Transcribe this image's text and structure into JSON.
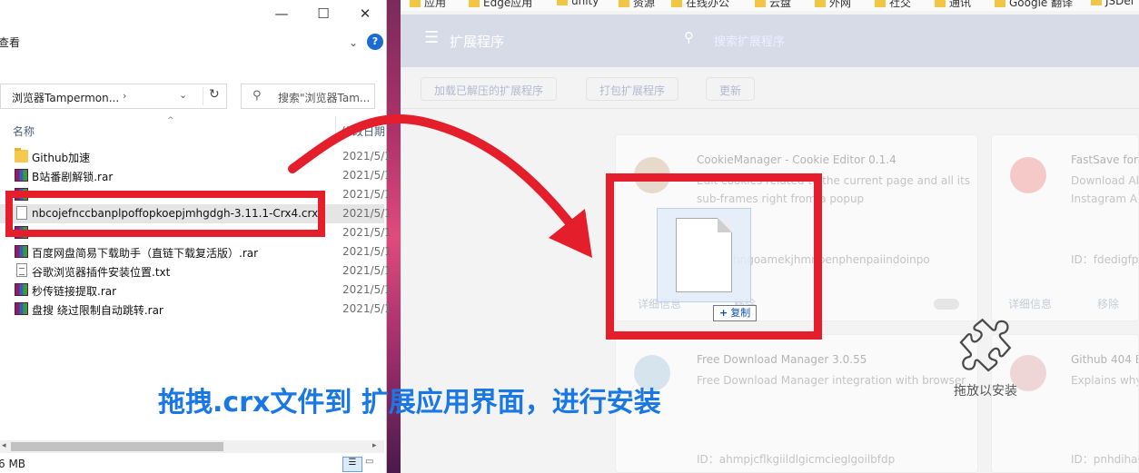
{
  "explorer": {
    "ribbon_tab": "查看",
    "window_controls": {
      "minimize": "—",
      "maximize": "☐",
      "close": "✕"
    },
    "address_path": "浏览器Tampermon...",
    "search_placeholder": "搜索\"浏览器Tam...",
    "columns": {
      "name": "名称",
      "date": "修改日期"
    },
    "files": [
      {
        "name": "Github加速",
        "date": "2021/5/1",
        "type": "folder"
      },
      {
        "name": "B站番剧解锁.rar",
        "date": "2021/5/1",
        "type": "rar"
      },
      {
        "name": "",
        "date": "2021/5/1",
        "type": "rar"
      },
      {
        "name": "nbcojefnccbanplpoffopkoepjmhgdgh-3.11.1-Crx4.crx",
        "date": "2021/5/1",
        "type": "file",
        "selected": true
      },
      {
        "name": "",
        "date": "2021/5/1",
        "type": "rar"
      },
      {
        "name": "百度网盘简易下载助手（直链下载复活版）.rar",
        "date": "2021/5/1",
        "type": "rar"
      },
      {
        "name": "谷歌浏览器插件安装位置.txt",
        "date": "2021/5/1",
        "type": "txt"
      },
      {
        "name": "秒传链接提取.rar",
        "date": "2021/5/1",
        "type": "rar"
      },
      {
        "name": "盘搜 绕过限制自动跳转.rar",
        "date": "2021/5/1",
        "type": "rar"
      }
    ],
    "status_size": "6 MB"
  },
  "edge": {
    "bookmarks": [
      "应用",
      "Edge应用",
      "unity",
      "资源",
      "在线办公",
      "云盘",
      "外网",
      "社交",
      "通讯",
      "Google 翻译",
      "JSDel"
    ],
    "header_title": "扩展程序",
    "search_placeholder": "搜索扩展程序",
    "toolbar": {
      "load_unpacked": "加载已解压的扩展程序",
      "pack": "打包扩展程序",
      "update": "更新"
    },
    "cards": [
      {
        "name": "CookieManager - Cookie Editor",
        "version": "0.1.4",
        "desc1": "Edit cookies related to the current page and all its",
        "desc2": "sub-frames right from a popup",
        "id": "ID：hdhngoamekjhmnpenphenpaiindoinpo",
        "details": "详细信息",
        "remove": "移除"
      },
      {
        "name": "FastSave for",
        "version": "",
        "desc1": "Download All",
        "desc2": "Instagram A",
        "id": "ID：fdedigfpo",
        "details": "详细信息",
        "remove": "移除"
      },
      {
        "name": "Free Download Manager",
        "version": "3.0.55",
        "desc1": "Free Download Manager integration with browser",
        "desc2": "",
        "id": "ID：ahmpjcflkgiildlgicmcieglgoilbfdp",
        "details": "",
        "remove": ""
      },
      {
        "name": "Github 404 B",
        "version": "",
        "desc1": "Explains why",
        "desc2": "",
        "id": "ID：pnhdihat",
        "details": "",
        "remove": ""
      }
    ],
    "copy_tip": "复制",
    "drop_hint": "拖放以安装"
  },
  "caption": "拖拽.crx文件到 扩展应用界面，进行安装",
  "colors": {
    "annotation_red": "#e41e2b",
    "caption_blue": "#1978e6"
  }
}
